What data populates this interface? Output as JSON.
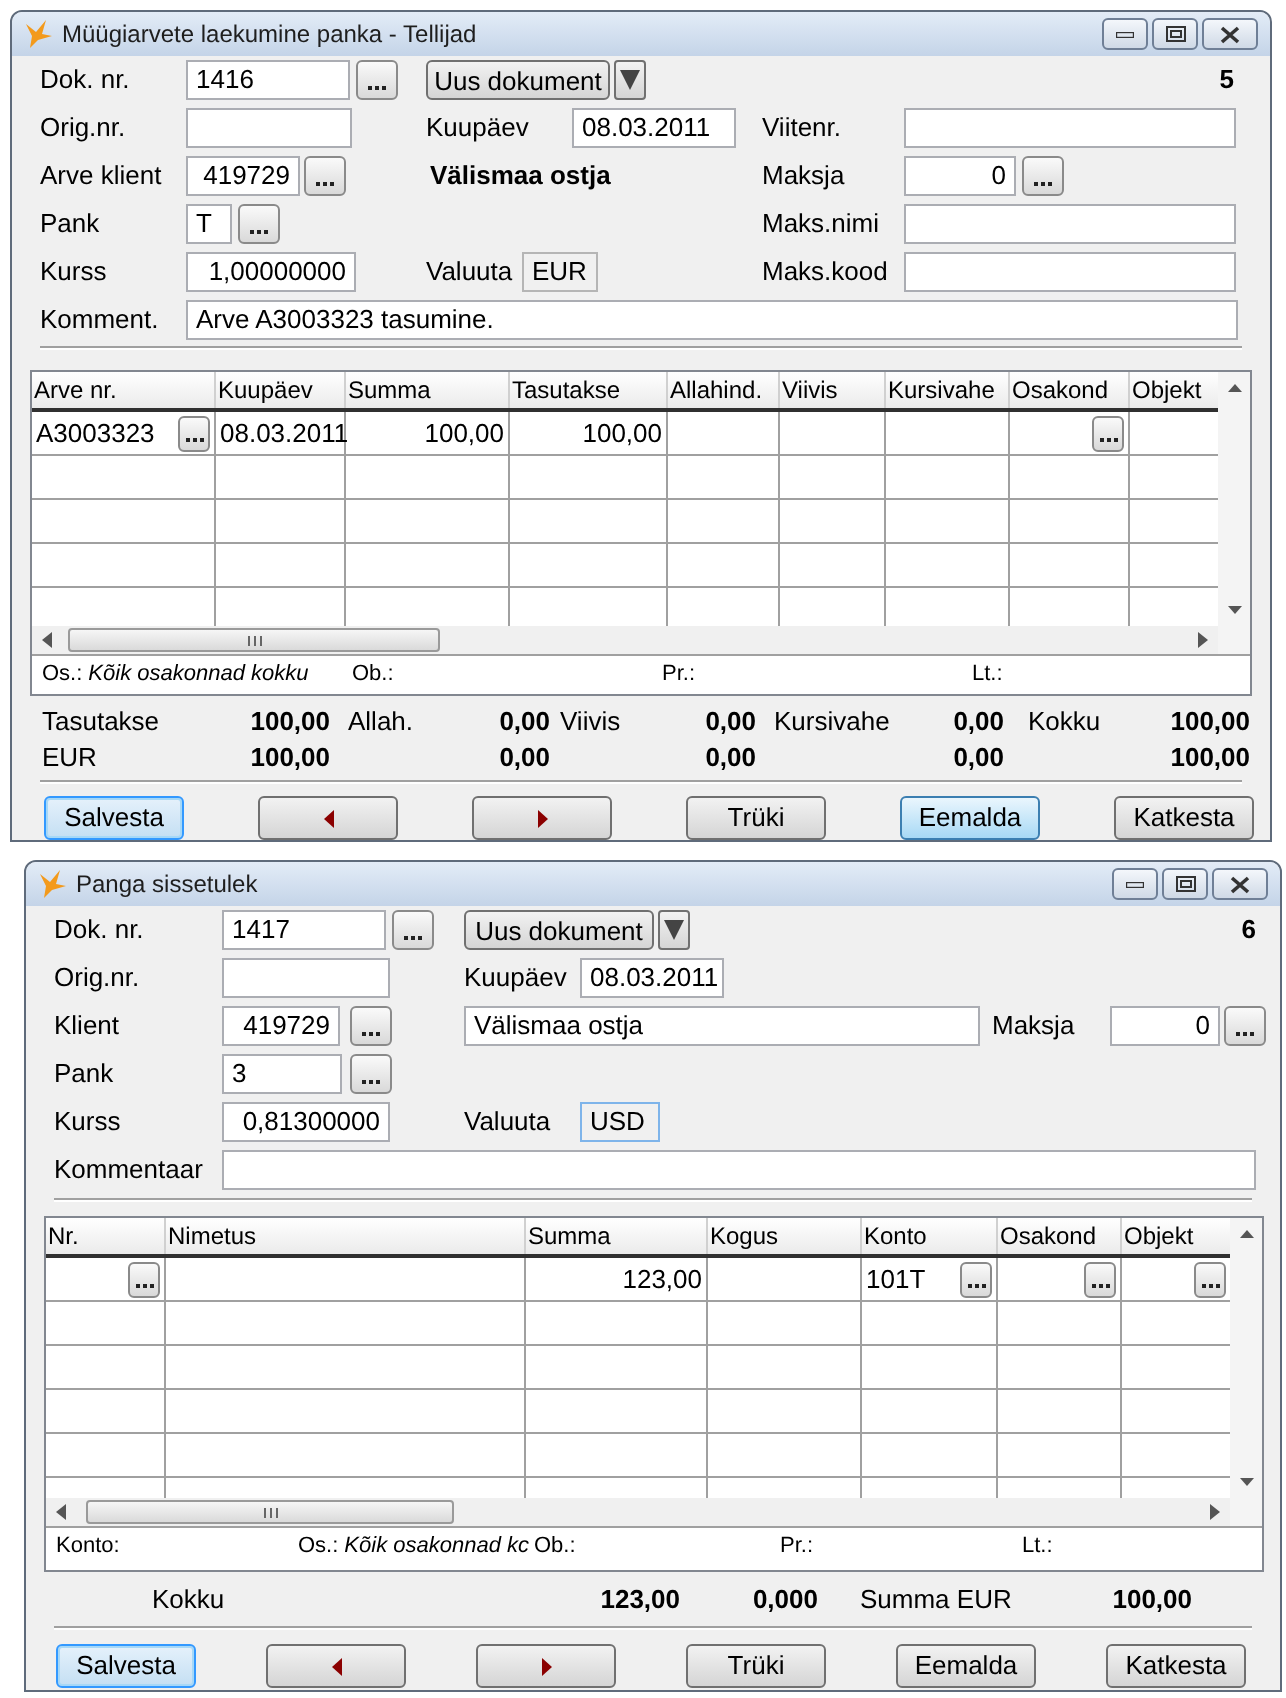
{
  "windows": [
    {
      "kind": "sales_receipt",
      "title": "Müügiarvete laekumine panka - Tellijad",
      "record_number": "5",
      "doc_number": {
        "label": "Dok. nr.",
        "value": "1416"
      },
      "new_document_button": "Uus dokument",
      "orig_number": {
        "label": "Orig.nr."
      },
      "date": {
        "label": "Kuupäev",
        "value": "08.03.2011"
      },
      "reference": {
        "label": "Viitenr."
      },
      "client": {
        "label": "Arve klient",
        "value": "419729",
        "name": "Välismaa ostja"
      },
      "payer": {
        "label": "Maksja",
        "value": "0"
      },
      "bank": {
        "label": "Pank",
        "value": "T"
      },
      "payer_name": {
        "label": "Maks.nimi"
      },
      "rate": {
        "label": "Kurss",
        "value": "1,00000000"
      },
      "currency": {
        "label": "Valuuta",
        "value": "EUR"
      },
      "payer_code": {
        "label": "Maks.kood"
      },
      "comment": {
        "label": "Komment.",
        "value": "Arve A3003323 tasumine."
      },
      "table": {
        "columns": [
          "Arve nr.",
          "Kuupäev",
          "Summa",
          "Tasutakse",
          "Allahind.",
          "Viivis",
          "Kursivahe",
          "Osakond",
          "Objekt"
        ],
        "rows": [
          {
            "cells": [
              {
                "text": "A3003323",
                "picker": true
              },
              {
                "text": "08.03.2011"
              },
              {
                "text": "100,00"
              },
              {
                "text": "100,00"
              },
              {},
              {},
              {},
              {
                "picker": true
              },
              {}
            ]
          }
        ],
        "status": [
          {
            "label": "Os.:",
            "value": "Kõik osakonnad kokku"
          },
          {
            "label": "Ob.:"
          },
          {
            "label": "Pr.:"
          },
          {
            "label": "Lt.:"
          }
        ]
      },
      "totals": [
        [
          {
            "label": "Tasutakse",
            "value": "100,00"
          },
          {
            "label": "Allah.",
            "value": "0,00"
          },
          {
            "label": "Viivis",
            "value": "0,00"
          },
          {
            "label": "Kursivahe",
            "value": "0,00"
          },
          {
            "label": "Kokku",
            "value": "100,00"
          }
        ],
        [
          {
            "label": "EUR",
            "value": "100,00"
          },
          {
            "value": "0,00"
          },
          {
            "value": "0,00"
          },
          {
            "value": "0,00"
          },
          {
            "value": "100,00"
          }
        ]
      ],
      "buttons": [
        {
          "kind": "text",
          "label": "Salvesta",
          "focused": true,
          "hovered": false
        },
        {
          "kind": "prev",
          "focused": false,
          "hovered": false
        },
        {
          "kind": "next",
          "focused": false,
          "hovered": false
        },
        {
          "kind": "text",
          "label": "Trüki",
          "focused": false,
          "hovered": false
        },
        {
          "kind": "text",
          "label": "Eemalda",
          "focused": false,
          "hovered": true
        },
        {
          "kind": "text",
          "label": "Katkesta",
          "focused": false,
          "hovered": false
        }
      ]
    },
    {
      "kind": "bank_income",
      "title": "Panga sissetulek",
      "record_number": "6",
      "doc_number": {
        "label": "Dok. nr.",
        "value": "1417"
      },
      "new_document_button": "Uus dokument",
      "orig_number": {
        "label": "Orig.nr."
      },
      "date": {
        "label": "Kuupäev",
        "value": "08.03.2011"
      },
      "client": {
        "label": "Klient",
        "value": "419729",
        "name": "Välismaa ostja"
      },
      "payer": {
        "label": "Maksja",
        "value": "0"
      },
      "bank": {
        "label": "Pank",
        "value": "3"
      },
      "rate": {
        "label": "Kurss",
        "value": "0,81300000"
      },
      "currency": {
        "label": "Valuuta",
        "value": "USD"
      },
      "comment": {
        "label": "Kommentaar"
      },
      "table": {
        "columns": [
          "Nr.",
          "Nimetus",
          "Summa",
          "Kogus",
          "Konto",
          "Osakond",
          "Objekt"
        ],
        "rows": [
          {
            "cells": [
              {
                "picker": true
              },
              {},
              {
                "text": "123,00"
              },
              {},
              {
                "text": "101T",
                "picker": true
              },
              {
                "picker": true
              },
              {
                "picker": true
              }
            ]
          }
        ],
        "status": [
          {
            "label": "Konto:"
          },
          {
            "label": "Os.:",
            "value": "Kõik osakonnad kc"
          },
          {
            "label": "Ob.:"
          },
          {
            "label": "Pr.:"
          },
          {
            "label": "Lt.:"
          }
        ]
      },
      "totals": [
        [
          {
            "label": "Kokku"
          },
          {
            "value": "123,00"
          },
          {
            "value": "0,000"
          },
          {
            "label": "Summa EUR"
          },
          {
            "value": "100,00"
          }
        ]
      ],
      "buttons": [
        {
          "kind": "text",
          "label": "Salvesta",
          "focused": true,
          "hovered": false
        },
        {
          "kind": "prev",
          "focused": false,
          "hovered": false
        },
        {
          "kind": "next",
          "focused": false,
          "hovered": false
        },
        {
          "kind": "text",
          "label": "Trüki",
          "focused": false,
          "hovered": false
        },
        {
          "kind": "text",
          "label": "Eemalda",
          "focused": false,
          "hovered": false
        },
        {
          "kind": "text",
          "label": "Katkesta",
          "focused": false,
          "hovered": false
        }
      ]
    }
  ]
}
